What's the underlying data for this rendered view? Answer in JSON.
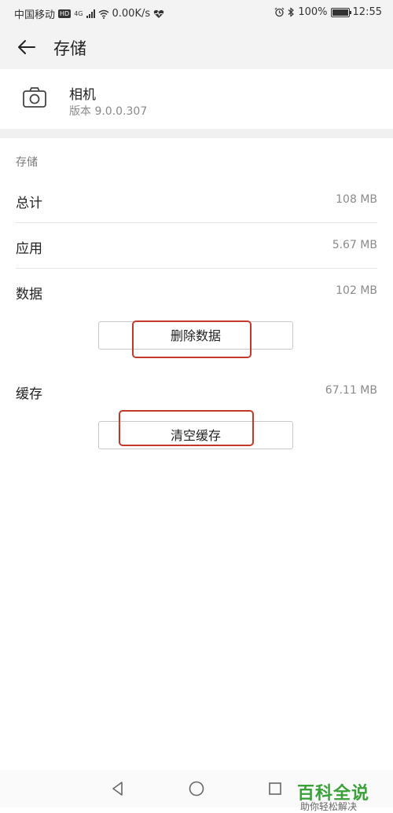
{
  "status_bar": {
    "carrier": "中国移动",
    "hd": "HD",
    "network": "4G",
    "speed": "0.00K/s",
    "battery": "100%",
    "time": "12:55"
  },
  "header": {
    "title": "存储"
  },
  "app": {
    "name": "相机",
    "version": "版本 9.0.0.307"
  },
  "storage": {
    "section_label": "存储",
    "rows": [
      {
        "label": "总计",
        "value": "108 MB"
      },
      {
        "label": "应用",
        "value": "5.67 MB"
      },
      {
        "label": "数据",
        "value": "102 MB"
      }
    ],
    "clear_data_label": "删除数据",
    "cache": {
      "label": "缓存",
      "value": "67.11 MB"
    },
    "clear_cache_label": "清空缓存"
  },
  "watermark": {
    "main": "百科全说",
    "sub": "助你轻松解决"
  },
  "colors": {
    "annotation": "#c0392b",
    "watermark": "#3aa03a"
  },
  "icons": {
    "back": "arrow-left-icon",
    "app": "camera-icon",
    "nav_back": "triangle-back-icon",
    "nav_home": "circle-home-icon",
    "nav_recent": "square-recent-icon"
  }
}
